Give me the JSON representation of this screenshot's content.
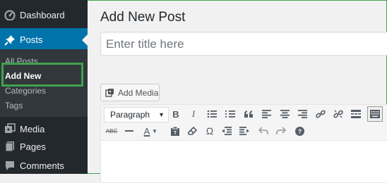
{
  "sidebar": {
    "items": [
      {
        "label": "Dashboard",
        "icon": "dashboard-icon"
      },
      {
        "label": "Posts",
        "icon": "pin-icon",
        "current": true
      },
      {
        "label": "Media",
        "icon": "media-icon"
      },
      {
        "label": "Pages",
        "icon": "pages-icon"
      },
      {
        "label": "Comments",
        "icon": "comments-icon"
      }
    ],
    "submenu": [
      "All Posts",
      "Add New",
      "Categories",
      "Tags"
    ],
    "current_sub": "Add New"
  },
  "main": {
    "page_title": "Add New Post",
    "title_placeholder": "Enter title here",
    "add_media_label": "Add Media",
    "format_select": "Paragraph"
  },
  "toolbar": {
    "row1": [
      "bold-icon",
      "italic-icon",
      "bulleted-list-icon",
      "numbered-list-icon",
      "blockquote-icon",
      "align-left-icon",
      "align-center-icon",
      "align-right-icon",
      "insert-link-icon",
      "remove-link-icon",
      "read-more-icon",
      "toolbar-toggle-icon"
    ],
    "row2": [
      "strikethrough-icon",
      "horizontal-line-icon",
      "text-color-icon",
      "paste-as-text-icon",
      "clear-formatting-icon",
      "special-character-icon",
      "decrease-indent-icon",
      "increase-indent-icon",
      "undo-icon",
      "redo-icon",
      "help-icon"
    ],
    "bold": "B",
    "italic": "I",
    "strikethrough": "ABC",
    "text_color": "A",
    "omega": "Ω",
    "help": "?"
  },
  "colors": {
    "sidebar": "#23282d",
    "submenu": "#32373c",
    "accent": "#0073aa",
    "highlight": "#3fa34d"
  }
}
